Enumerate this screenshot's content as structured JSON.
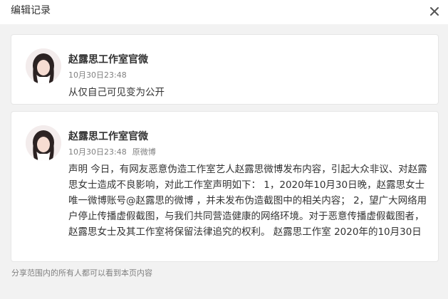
{
  "dialog": {
    "title": "编辑记录",
    "close_icon": "close-icon"
  },
  "records": [
    {
      "username": "赵露思工作室官微",
      "time": "10月30日23:48",
      "source": "",
      "text": "从仅自己可见变为公开"
    },
    {
      "username": "赵露思工作室官微",
      "time": "10月30日23:48",
      "source": "原微博",
      "text": "声明 今日，有网友恶意伪造工作室艺人赵露思微博发布内容，引起大众非议、对赵露思女士造成不良影响，对此工作室声明如下： 1，2020年10月30日晚，赵露思女士唯一微博账号@赵露思的微博 ，并未发布伪造截图中的相关内容； 2，望广大网络用户停止传播虚假截图，与我们共同营造健康的网络环境。对于恶意传播虚假截图者，赵露思女士及其工作室将保留法律追究的权利。 赵露思工作室 2020年的10月30日"
    }
  ],
  "footer": {
    "note": "分享范围内的所有人都可以看到本页内容"
  },
  "colors": {
    "background": "#f2f2f2",
    "card": "#ffffff",
    "text": "#333333",
    "muted": "#808080"
  }
}
